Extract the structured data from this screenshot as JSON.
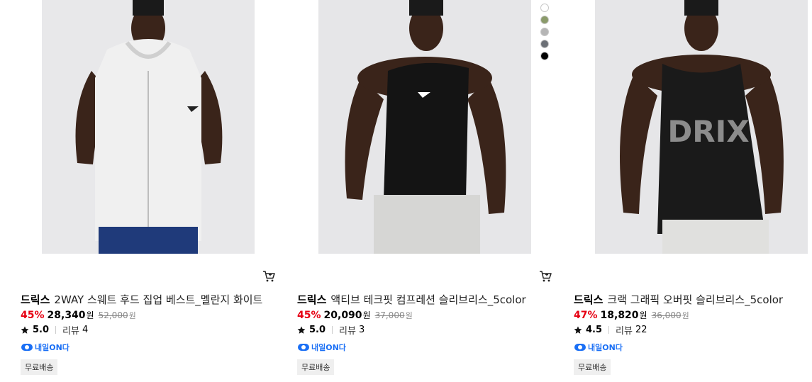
{
  "products": [
    {
      "brand": "드릭스",
      "name": "2WAY 스웨트 후드 집업 베스트_멜란지 화이트",
      "discount": "45%",
      "price": "28,340",
      "currency": "원",
      "original_price": "52,000",
      "rating": "5.0",
      "review_label": "리뷰",
      "review_count": "4",
      "delivery_badge": "내일ON다",
      "shipping_tag": "무료배송",
      "garment_color": "#f0f0f0",
      "swatches": []
    },
    {
      "brand": "드릭스",
      "name": "액티브 테크핏 컴프레션 슬리브리스_5color",
      "discount": "45%",
      "price": "20,090",
      "currency": "원",
      "original_price": "37,000",
      "rating": "5.0",
      "review_label": "리뷰",
      "review_count": "3",
      "delivery_badge": "내일ON다",
      "shipping_tag": "무료배송",
      "garment_color": "#141414",
      "swatches": [
        "#ffffff",
        "#8a9a6a",
        "#b5b5b5",
        "#6b6f75",
        "#000000"
      ]
    },
    {
      "brand": "드릭스",
      "name": "크랙 그래픽 오버핏 슬리브리스_5color",
      "discount": "47%",
      "price": "18,820",
      "currency": "원",
      "original_price": "36,000",
      "rating": "4.5",
      "review_label": "리뷰",
      "review_count": "22",
      "delivery_badge": "내일ON다",
      "shipping_tag": "무료배송",
      "garment_color": "#1a1a1a",
      "graphic_text": "DRIX",
      "swatches": [
        "#ffffff",
        "#4e6a2e",
        "#5a2f1a",
        "#5e6166",
        "#000000"
      ]
    }
  ],
  "icons": {
    "cart": "cart-icon",
    "star": "star-icon",
    "delivery": "delivery-truck-icon"
  }
}
